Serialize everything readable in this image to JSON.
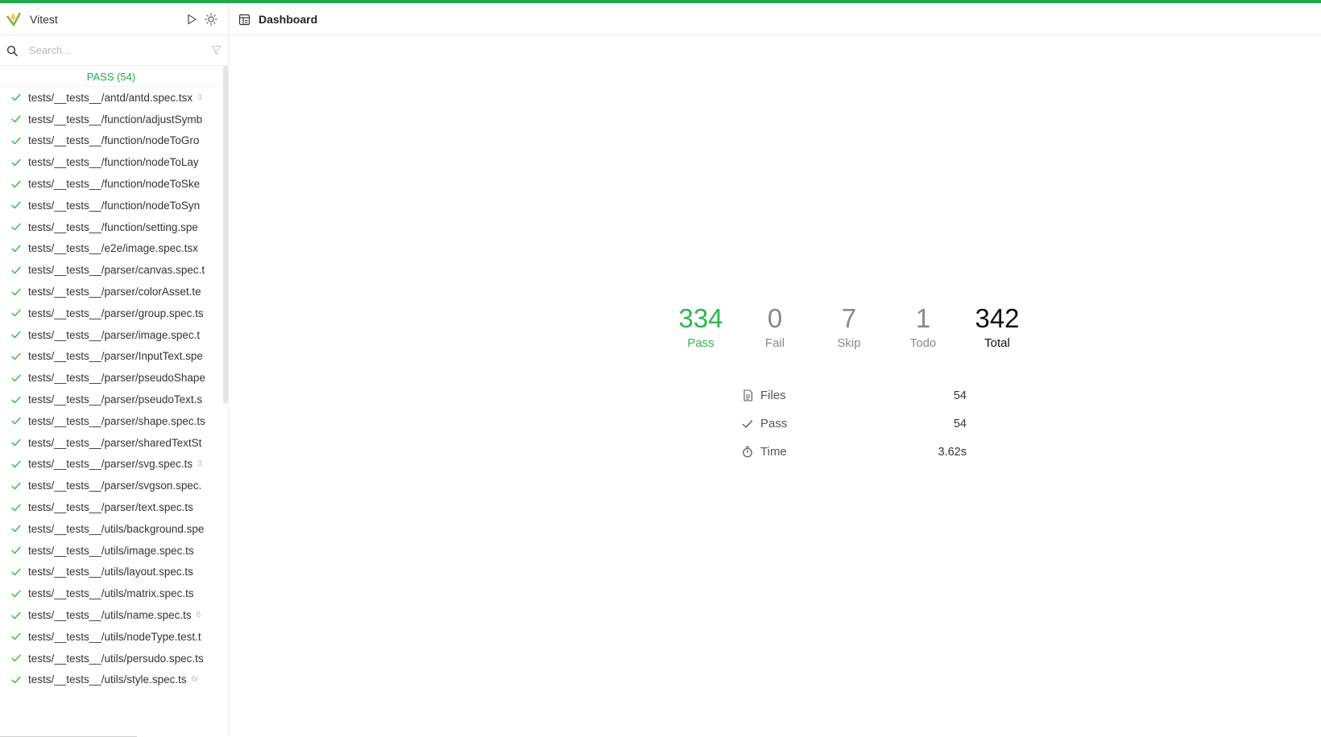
{
  "app": {
    "title": "Vitest"
  },
  "search": {
    "placeholder": "Search..."
  },
  "sidebar": {
    "pass_heading": "PASS (54)",
    "files": [
      {
        "name": "tests/__tests__/antd/antd.spec.tsx",
        "duration": "3"
      },
      {
        "name": "tests/__tests__/function/adjustSymb",
        "duration": ""
      },
      {
        "name": "tests/__tests__/function/nodeToGro",
        "duration": ""
      },
      {
        "name": "tests/__tests__/function/nodeToLay",
        "duration": ""
      },
      {
        "name": "tests/__tests__/function/nodeToSke",
        "duration": ""
      },
      {
        "name": "tests/__tests__/function/nodeToSyn",
        "duration": ""
      },
      {
        "name": "tests/__tests__/function/setting.spe",
        "duration": ""
      },
      {
        "name": "tests/__tests__/e2e/image.spec.tsx",
        "duration": ""
      },
      {
        "name": "tests/__tests__/parser/canvas.spec.t",
        "duration": ""
      },
      {
        "name": "tests/__tests__/parser/colorAsset.te",
        "duration": ""
      },
      {
        "name": "tests/__tests__/parser/group.spec.ts",
        "duration": ""
      },
      {
        "name": "tests/__tests__/parser/image.spec.t",
        "duration": ""
      },
      {
        "name": "tests/__tests__/parser/InputText.spe",
        "duration": ""
      },
      {
        "name": "tests/__tests__/parser/pseudoShape",
        "duration": ""
      },
      {
        "name": "tests/__tests__/parser/pseudoText.s",
        "duration": ""
      },
      {
        "name": "tests/__tests__/parser/shape.spec.ts",
        "duration": ""
      },
      {
        "name": "tests/__tests__/parser/sharedTextSt",
        "duration": ""
      },
      {
        "name": "tests/__tests__/parser/svg.spec.ts",
        "duration": "3"
      },
      {
        "name": "tests/__tests__/parser/svgson.spec.",
        "duration": ""
      },
      {
        "name": "tests/__tests__/parser/text.spec.ts",
        "duration": ""
      },
      {
        "name": "tests/__tests__/utils/background.spe",
        "duration": ""
      },
      {
        "name": "tests/__tests__/utils/image.spec.ts",
        "duration": ""
      },
      {
        "name": "tests/__tests__/utils/layout.spec.ts",
        "duration": ""
      },
      {
        "name": "tests/__tests__/utils/matrix.spec.ts",
        "duration": ""
      },
      {
        "name": "tests/__tests__/utils/name.spec.ts",
        "duration": "6"
      },
      {
        "name": "tests/__tests__/utils/nodeType.test.t",
        "duration": ""
      },
      {
        "name": "tests/__tests__/utils/persudo.spec.ts",
        "duration": ""
      },
      {
        "name": "tests/__tests__/utils/style.spec.ts",
        "duration": "6r"
      }
    ]
  },
  "main": {
    "header_title": "Dashboard",
    "stats": {
      "pass": {
        "value": "334",
        "label": "Pass"
      },
      "fail": {
        "value": "0",
        "label": "Fail"
      },
      "skip": {
        "value": "7",
        "label": "Skip"
      },
      "todo": {
        "value": "1",
        "label": "Todo"
      },
      "total": {
        "value": "342",
        "label": "Total"
      }
    },
    "summary": {
      "files": {
        "label": "Files",
        "value": "54"
      },
      "pass": {
        "label": "Pass",
        "value": "54"
      },
      "time": {
        "label": "Time",
        "value": "3.62s"
      }
    }
  },
  "colors": {
    "accent": "#22a84a",
    "pass": "#2db84d",
    "muted": "#888888"
  },
  "icons": {
    "logo": "vitest-logo-icon",
    "run": "play-icon",
    "theme": "sun-icon",
    "search": "search-icon",
    "filter": "filter-icon",
    "check": "check-icon",
    "dashboard": "dashboard-icon",
    "files": "file-icon",
    "time": "timer-icon"
  }
}
